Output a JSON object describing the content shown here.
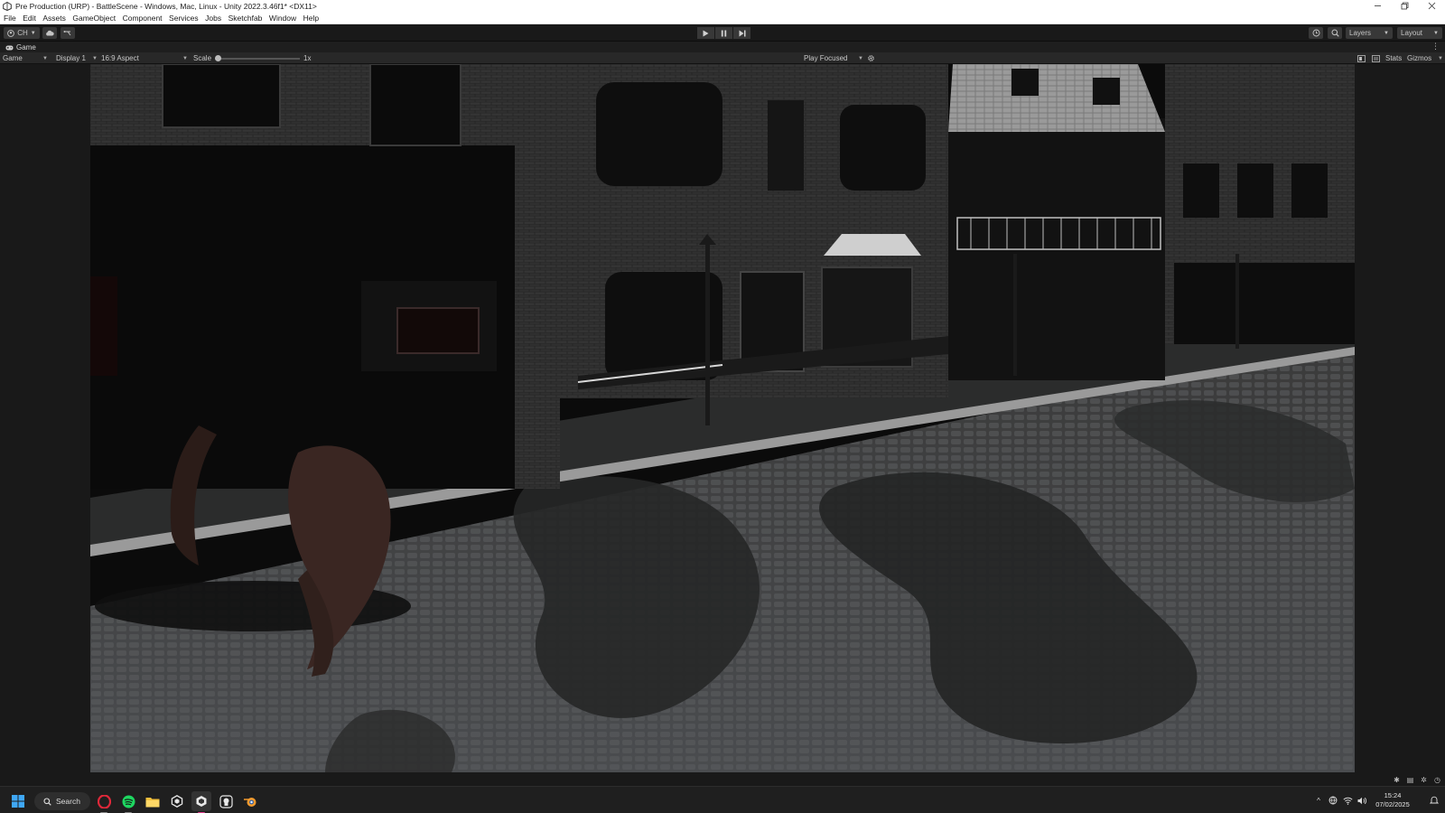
{
  "window": {
    "title": "Pre Production (URP) - BattleScene - Windows, Mac, Linux - Unity 2022.3.46f1* <DX11>",
    "controls": [
      "minimize",
      "restore",
      "close"
    ]
  },
  "menu": [
    "File",
    "Edit",
    "Assets",
    "GameObject",
    "Component",
    "Services",
    "Jobs",
    "Sketchfab",
    "Window",
    "Help"
  ],
  "toolbar": {
    "account_label": "CH",
    "layers_label": "Layers",
    "layout_label": "Layout"
  },
  "game_tab": {
    "label": "Game"
  },
  "game_view": {
    "mode": "Game",
    "display": "Display 1",
    "aspect": "16:9 Aspect",
    "scale_label": "Scale",
    "scale_value": "1x",
    "play_mode": "Play Focused",
    "stats_label": "Stats",
    "gizmos_label": "Gizmos"
  },
  "taskbar": {
    "search_label": "Search",
    "apps": [
      "opera",
      "spotify",
      "file-explorer",
      "unity-hub",
      "unity-editor",
      "github-desktop",
      "blender"
    ],
    "clock_time": "15:24",
    "clock_date": "07/02/2025"
  },
  "colors": {
    "editor_bg": "#191919",
    "toolbar_button": "#383838",
    "menubar_bg": "#ffffff",
    "taskbar_bg": "#1f1f1f",
    "active_indicator": "#e03a8c"
  }
}
